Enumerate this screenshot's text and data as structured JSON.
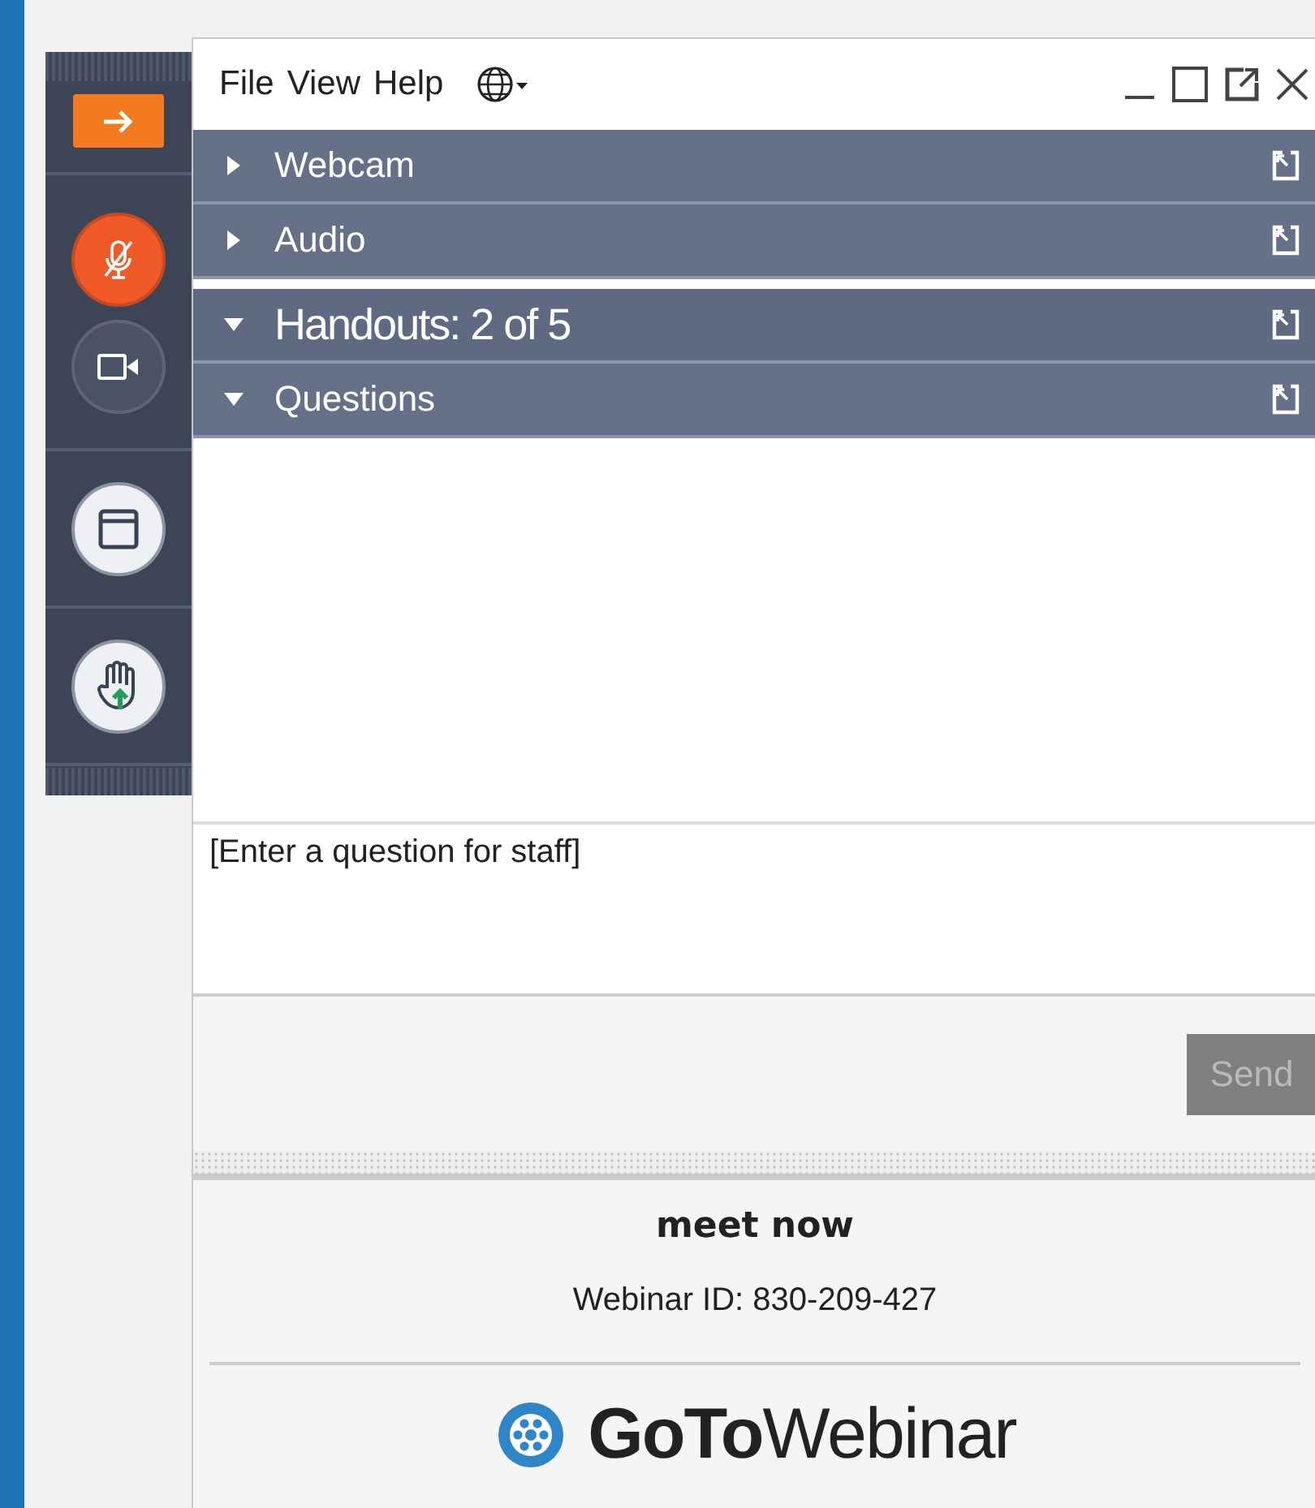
{
  "toolbar": {
    "items": [
      {
        "kind": "collapse"
      },
      {
        "kind": "mic",
        "muted": true
      },
      {
        "kind": "camera",
        "on": false
      },
      {
        "kind": "panel"
      },
      {
        "kind": "hand"
      }
    ]
  },
  "menu": {
    "items": [
      "File",
      "View",
      "Help"
    ]
  },
  "panels": [
    {
      "title": "Webcam",
      "expanded": false
    },
    {
      "title": "Audio",
      "expanded": false
    },
    {
      "title": "Handouts: 2 of 5",
      "expanded": true
    },
    {
      "title": "Questions",
      "expanded": true
    }
  ],
  "question": {
    "placeholder": "[Enter a question for staff]",
    "send": {
      "label": "Send",
      "disabled": true
    }
  },
  "footer": {
    "title": "meet now",
    "webinar_id": "Webinar ID: 830-209-427",
    "logo": "**GoTo**Webinar"
  }
}
